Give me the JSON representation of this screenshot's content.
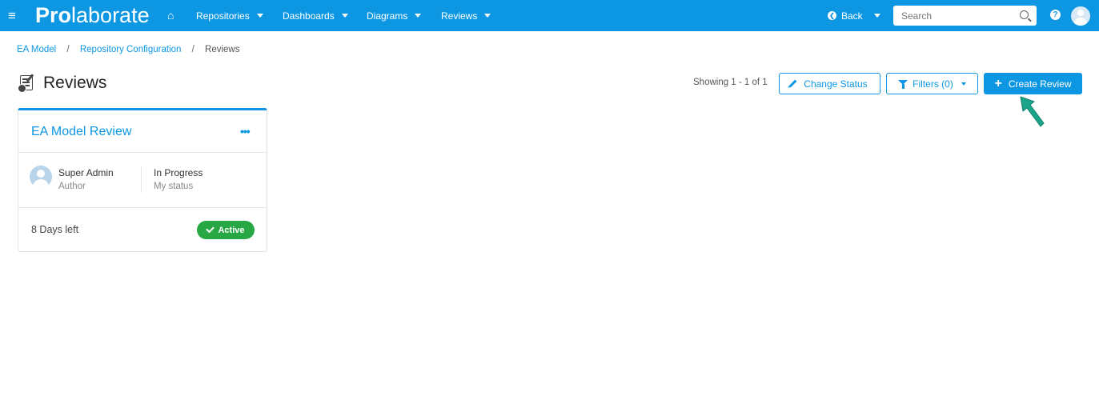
{
  "navbar": {
    "logo_bold": "Pro",
    "logo_light": "laborate",
    "menus": [
      {
        "label": "Repositories"
      },
      {
        "label": "Dashboards"
      },
      {
        "label": "Diagrams"
      },
      {
        "label": "Reviews"
      }
    ],
    "back_label": "Back",
    "search_placeholder": "Search",
    "help_glyph": "?"
  },
  "breadcrumb": {
    "items": [
      "EA Model",
      "Repository Configuration"
    ],
    "current": "Reviews",
    "separator": "/"
  },
  "page": {
    "title": "Reviews",
    "showing": "Showing 1 - 1 of 1"
  },
  "toolbar": {
    "change_status_label": "Change Status",
    "filters_label": "Filters (0)",
    "create_review_label": "Create Review"
  },
  "card": {
    "title": "EA Model Review",
    "more_glyph": "•••",
    "author_name": "Super Admin",
    "author_role": "Author",
    "status_value": "In Progress",
    "status_label": "My status",
    "days_left": "8 Days left",
    "badge_label": "Active"
  },
  "colors": {
    "brand_blue": "#0d97e3",
    "active_green": "#27a844",
    "annotation_arrow": "#1aa58a"
  },
  "icons": {
    "menu": "hamburger-icon",
    "home": "home-icon",
    "back": "back-circle-icon",
    "search": "search-icon",
    "help": "help-icon",
    "user": "user-avatar-icon",
    "title": "review-document-icon",
    "change_status": "pencil-icon",
    "filters": "filter-icon",
    "create": "plus-icon",
    "active": "check-icon"
  }
}
